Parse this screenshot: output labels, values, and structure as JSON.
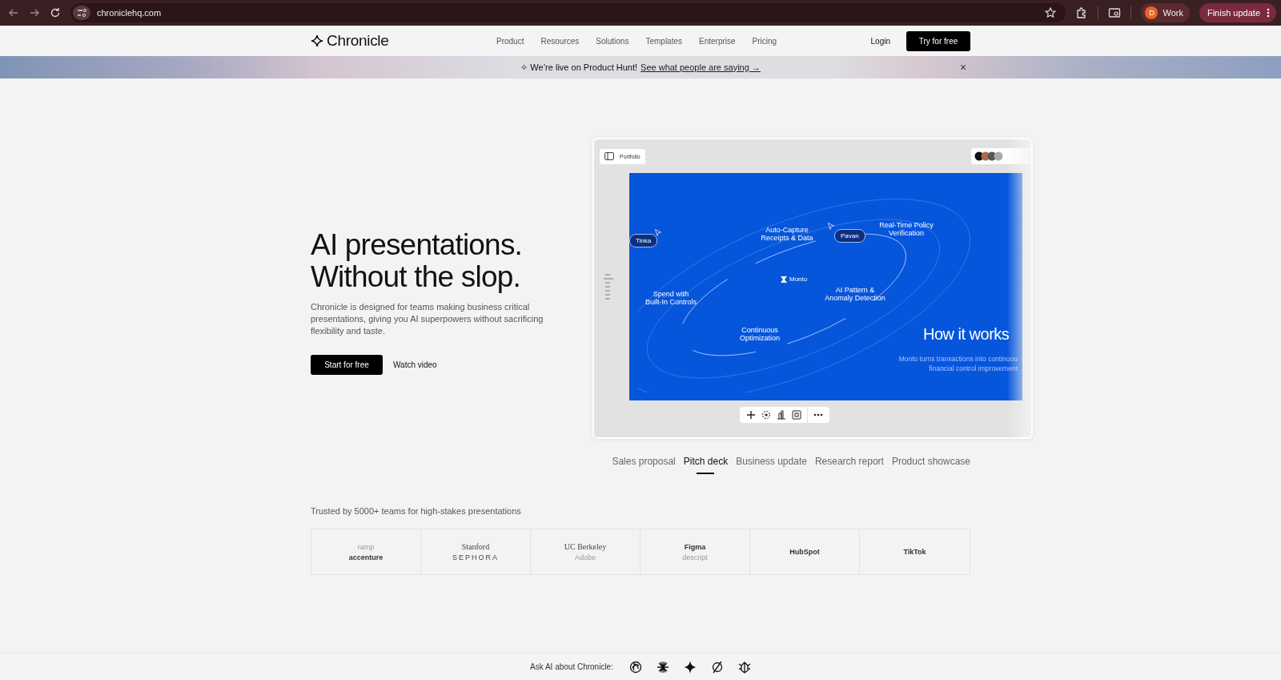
{
  "browser": {
    "url": "chroniclehq.com",
    "profile": {
      "initial": "D",
      "label": "Work"
    },
    "update_button": "Finish update"
  },
  "nav": {
    "logo": "Chronicle",
    "links": [
      "Product",
      "Resources",
      "Solutions",
      "Templates",
      "Enterprise",
      "Pricing"
    ],
    "login": "Login",
    "cta": "Try for free"
  },
  "banner": {
    "text": "✧ We’re live on Product Hunt!",
    "link": "See what people are saying →",
    "close": "×"
  },
  "hero": {
    "title_lines": [
      "AI presentations.",
      "Without the slop."
    ],
    "subtitle": "Chronicle is designed for teams making business critical presentations, giving you AI superpowers without sacrificing flexibility and taste.",
    "primary": "Start for free",
    "secondary": "Watch video"
  },
  "preview": {
    "doc_button": "Portfolio",
    "slide": {
      "labels": [
        "Auto-Capture\nReceipts & Data",
        "Real-Time Policy\nVerification",
        "Spend with\nBuilt-In Controls",
        "AI Pattern &\nAnomaly Detection",
        "Continuous\nOptimization"
      ],
      "brand": "Monto",
      "cursors": [
        "Tinka",
        "Pavan"
      ],
      "heading": "How it works",
      "body_lines": [
        "Monto turns transactions into continuou",
        "financial control improvement"
      ]
    }
  },
  "template_tabs": [
    {
      "label": "Sales proposal",
      "selected": false
    },
    {
      "label": "Pitch deck",
      "selected": true
    },
    {
      "label": "Business update",
      "selected": false
    },
    {
      "label": "Research report",
      "selected": false
    },
    {
      "label": "Product showcase",
      "selected": false
    }
  ],
  "trusted": {
    "text": "Trusted by 5000+ teams for high-stakes presentations",
    "logos": [
      [
        {
          "name": "ramp",
          "faded": true
        },
        {
          "name": "accenture",
          "faded": false
        }
      ],
      [
        {
          "name": "Stanford",
          "faded": false
        },
        {
          "name": "SEPHORA",
          "faded": false
        }
      ],
      [
        {
          "name": "UC Berkeley",
          "faded": false
        },
        {
          "name": "Adobe",
          "faded": true
        }
      ],
      [
        {
          "name": "Figma",
          "faded": false
        },
        {
          "name": "descript",
          "faded": true
        }
      ],
      [
        {
          "name": "HubSpot",
          "faded": false
        }
      ],
      [
        {
          "name": "TikTok",
          "faded": false
        }
      ]
    ]
  },
  "ask_ai": {
    "label": "Ask AI about Chronicle:"
  }
}
